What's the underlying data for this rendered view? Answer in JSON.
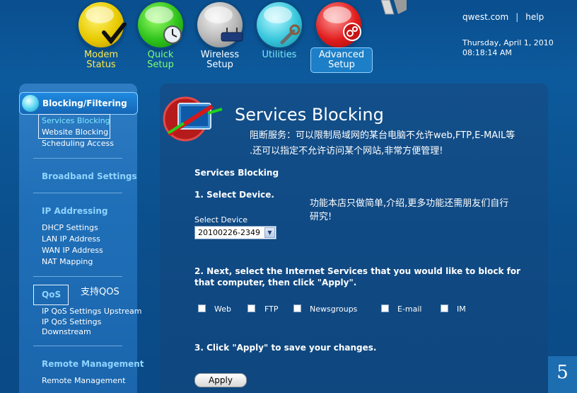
{
  "nav": {
    "modem_status_label": "Modem\nStatus",
    "quick_setup_label": "Quick\nSetup",
    "wireless_setup_label": "Wireless\nSetup",
    "utilities_label": "Utilities",
    "advanced_setup_label": "Advanced\nSetup"
  },
  "header": {
    "qwest_link": "qwest.com",
    "separator": "|",
    "help_link": "help",
    "date": "Thursday, April 1, 2010",
    "time": "08:18:14  AM"
  },
  "sidebar": {
    "heading": "Blocking/Filtering",
    "items_blocking": [
      "Services Blocking",
      "Website Blocking",
      "Scheduling Access"
    ],
    "broadband_settings": "Broadband Settings",
    "ip_addressing": "IP Addressing",
    "items_ip": [
      "DHCP Settings",
      "LAN IP Address",
      "WAN IP Address",
      "NAT Mapping"
    ],
    "qos": "QoS",
    "qos_note": "支持QOS",
    "items_qos": [
      "IP QoS Settings Upstream",
      "IP QoS Settings",
      "Downstream"
    ],
    "remote_management_heading": "Remote Management",
    "remote_management_item": "Remote Management"
  },
  "main": {
    "title": "Services Blocking",
    "annotation_line1": "阻断服务：可以限制局域网的某台电脑不允许web,FTP,E-MAIL等",
    "annotation_line2": ".还可以指定不允许访问某个网站,非常方便管理!",
    "section_title": "Services Blocking",
    "step1": "1. Select Device.",
    "note_line1": "功能本店只做简单,介绍,更多功能还需朋友们自行",
    "note_line2": "研究!",
    "select_label": "Select Device",
    "select_value": "20100226-2349",
    "step2": "2. Next, select the Internet Services that you would like to block for that computer, then click \"Apply\".",
    "services": [
      "Web",
      "FTP",
      "Newsgroups",
      "E-mail",
      "IM"
    ],
    "step3": "3. Click \"Apply\" to save your changes.",
    "apply_label": "Apply"
  },
  "page_number": "5"
}
